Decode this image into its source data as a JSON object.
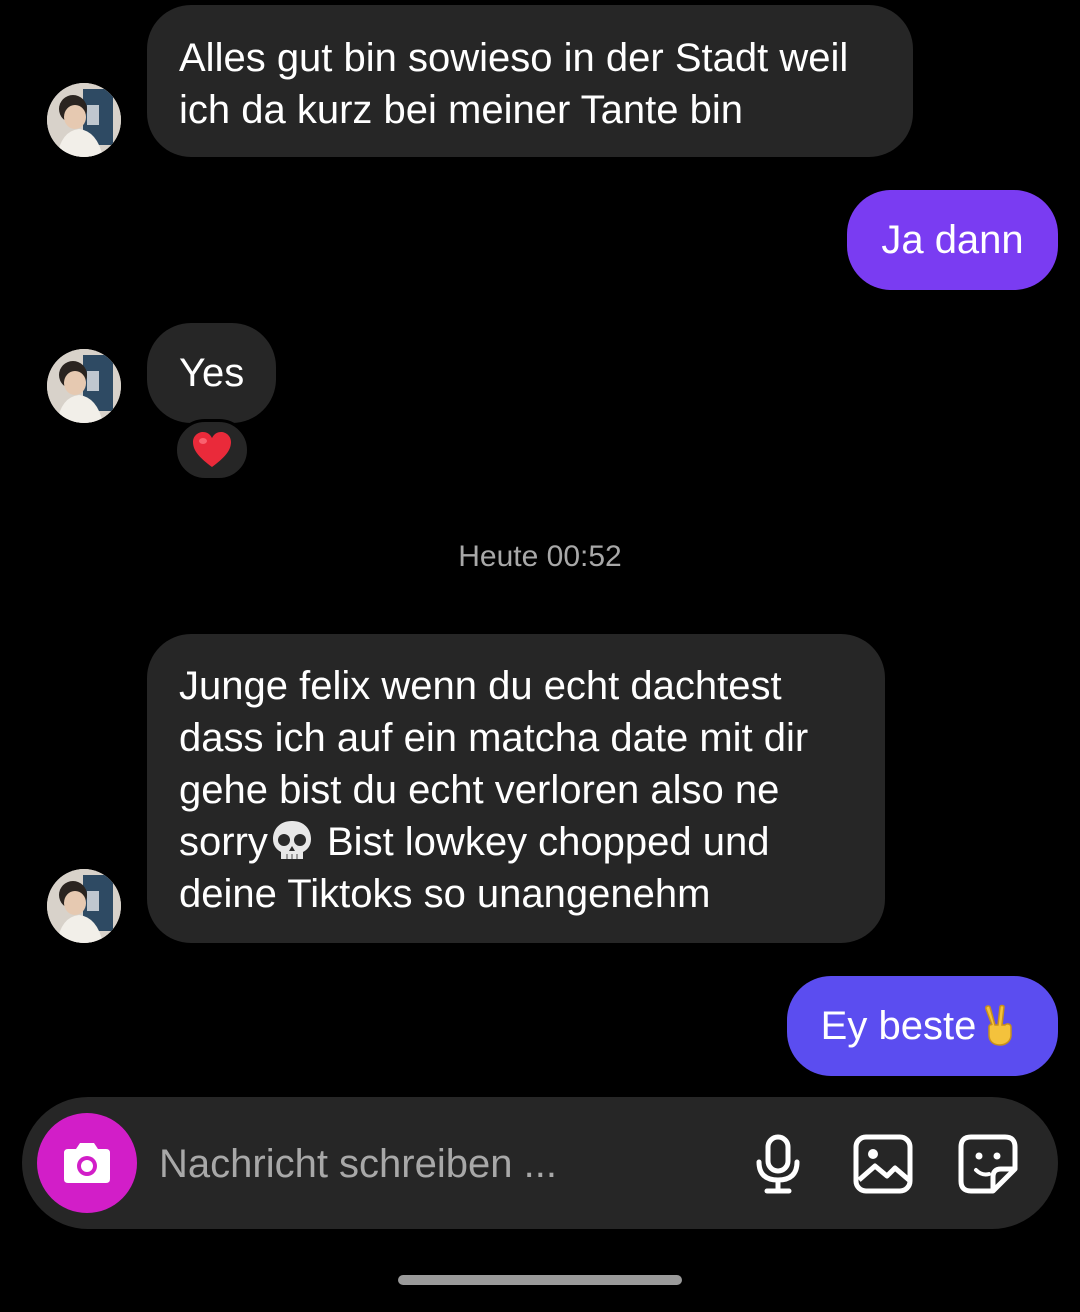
{
  "messages": [
    {
      "direction": "incoming",
      "text": "Alles gut bin sowieso in der Stadt weil\nich da kurz bei meiner Tante bin"
    },
    {
      "direction": "outgoing",
      "text": "Ja dann"
    },
    {
      "direction": "incoming",
      "text": "Yes",
      "reaction": "red-heart-emoji"
    },
    {
      "direction": "incoming",
      "text_before_emoji": "Junge felix wenn du echt dachtest\ndass ich auf ein matcha date mit dir\ngehe bist du echt verloren also ne\nsorry",
      "emoji": "skull-emoji",
      "text_after_emoji": " Bist lowkey chopped und\ndeine Tiktoks so unangenehm"
    },
    {
      "direction": "outgoing",
      "text": "Ey beste",
      "emoji": "victory-hand-emoji"
    }
  ],
  "timestamp": "Heute 00:52",
  "composer": {
    "placeholder": "Nachricht schreiben ...",
    "icons": [
      "camera-icon",
      "microphone-icon",
      "gallery-icon",
      "sticker-icon"
    ]
  },
  "colors": {
    "background": "#000000",
    "incoming_bubble": "#262626",
    "outgoing_bubble": "#7a3cf2",
    "outgoing_bubble_latest": "#5b4df0",
    "camera_button": "#d21ec8",
    "timestamp_text": "#a8a8a8"
  }
}
